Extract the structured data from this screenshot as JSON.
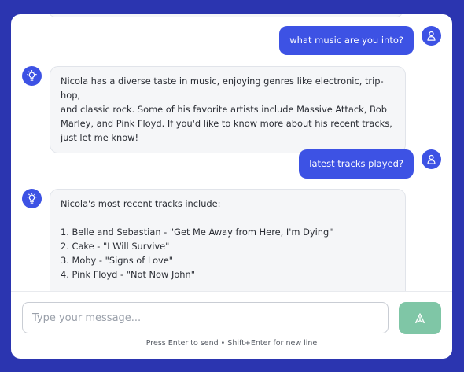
{
  "conversation": [
    {
      "role": "user",
      "text": "what music are you into?"
    },
    {
      "role": "assistant",
      "lines": [
        "Nicola has a diverse taste in music, enjoying genres like electronic, trip-hop,",
        "and classic rock. Some of his favorite artists include Massive Attack, Bob",
        "Marley, and Pink Floyd. If you'd like to know more about his recent tracks,",
        "just let me know!"
      ]
    },
    {
      "role": "user",
      "text": "latest tracks played?"
    },
    {
      "role": "assistant",
      "intro": "Nicola's most recent tracks include:",
      "tracks": [
        "1. Belle and Sebastian - \"Get Me Away from Here, I'm Dying\"",
        "2. Cake - \"I Will Survive\"",
        "3. Moby - \"Signs of Love\"",
        "4. Pink Floyd - \"Not Now John\""
      ]
    }
  ],
  "composer": {
    "placeholder": "Type your message...",
    "hint": "Press Enter to send • Shift+Enter for new line"
  },
  "icons": {
    "user_avatar": "user-icon",
    "assistant_avatar": "lightbulb-icon",
    "send": "send-icon"
  },
  "colors": {
    "background": "#2b35b0",
    "accent": "#3d52e4",
    "send_button": "#7fc6a6"
  }
}
